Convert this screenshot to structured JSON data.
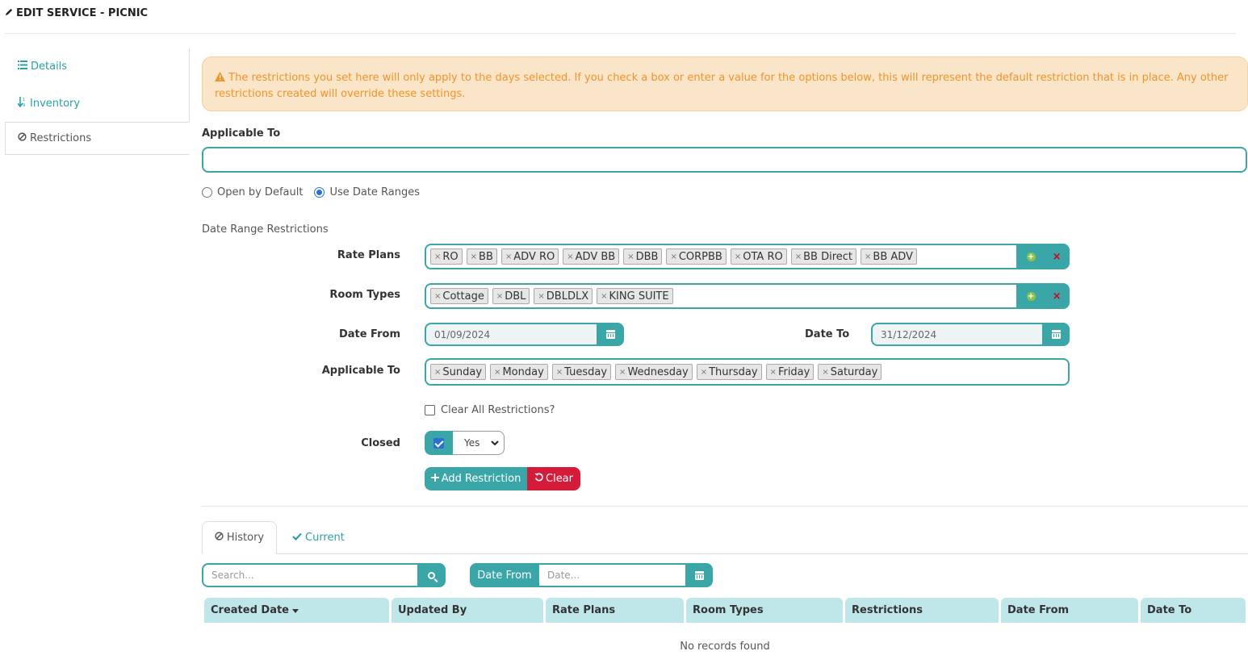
{
  "header": {
    "title": "EDIT SERVICE - PICNIC"
  },
  "nav": [
    {
      "label": "Details",
      "icon": "list-icon"
    },
    {
      "label": "Inventory",
      "icon": "sort-icon"
    },
    {
      "label": "Restrictions",
      "icon": "ban-icon"
    }
  ],
  "alert": {
    "text": "The restrictions you set here will only apply to the days selected. If you check a box or enter a value for the options below, this will represent the default restriction that is in place. Any other restrictions created will override these settings."
  },
  "applicable_to_top": {
    "label": "Applicable To",
    "value": ""
  },
  "radios": {
    "open_by_default": "Open by Default",
    "use_date_ranges": "Use Date Ranges",
    "selected": "use_date_ranges"
  },
  "section_title": "Date Range Restrictions",
  "rate_plans": {
    "label": "Rate Plans",
    "tags": [
      "RO",
      "BB",
      "ADV RO",
      "ADV BB",
      "DBB",
      "CORPBB",
      "OTA RO",
      "BB Direct",
      "BB ADV"
    ]
  },
  "room_types": {
    "label": "Room Types",
    "tags": [
      "Cottage",
      "DBL",
      "DBLDLX",
      "KING SUITE"
    ]
  },
  "date_from": {
    "label": "Date From",
    "value": "01/09/2024"
  },
  "date_to": {
    "label": "Date To",
    "value": "31/12/2024"
  },
  "applicable_days": {
    "label": "Applicable To",
    "tags": [
      "Sunday",
      "Monday",
      "Tuesday",
      "Wednesday",
      "Thursday",
      "Friday",
      "Saturday"
    ]
  },
  "clear_all": {
    "label": "Clear All Restrictions?",
    "checked": false
  },
  "closed": {
    "label": "Closed",
    "checked": true,
    "select_value": "Yes"
  },
  "buttons": {
    "add_restriction": "Add Restriction",
    "clear": "Clear"
  },
  "tabs": {
    "history": "History",
    "current": "Current",
    "active": "history"
  },
  "filters": {
    "search_placeholder": "Search...",
    "date_from_label": "Date From",
    "date_placeholder": "Date..."
  },
  "table": {
    "columns": [
      "Created Date",
      "Updated By",
      "Rate Plans",
      "Room Types",
      "Restrictions",
      "Date From",
      "Date To"
    ],
    "sort_column": "Created Date",
    "empty_message": "No records found"
  },
  "colors": {
    "accent": "#3aa6a8",
    "danger": "#d51b3a",
    "warning_bg": "#fbe5c8",
    "warning_text": "#f0932b",
    "table_header": "#bfe6e8"
  }
}
